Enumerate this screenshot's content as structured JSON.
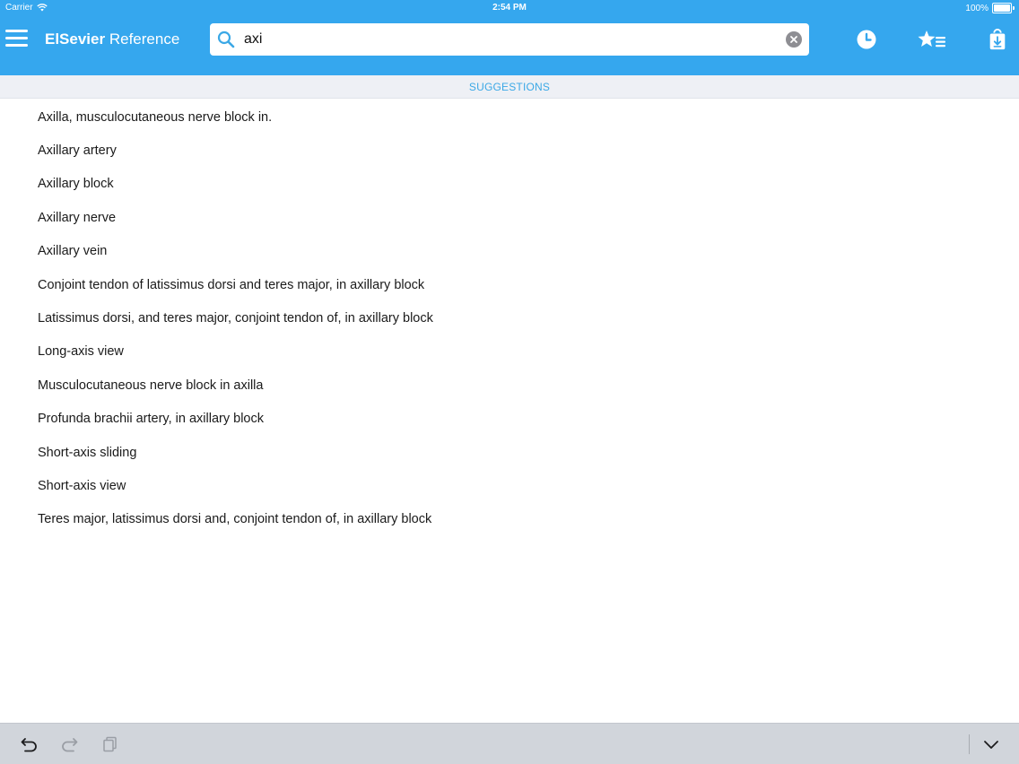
{
  "status_bar": {
    "carrier": "Carrier",
    "time": "2:54 PM",
    "battery": "100%",
    "wifi_icon": "wifi-icon",
    "battery_icon": "battery-icon"
  },
  "nav": {
    "menu_icon": "hamburger-menu-icon",
    "brand_bold": "ElSevier",
    "brand_light": "Reference",
    "search": {
      "value": "axi",
      "icon": "search-icon",
      "clear_icon": "clear-icon"
    },
    "actions": [
      "history-clock-icon",
      "favorites-list-icon",
      "downloads-icon"
    ],
    "accent_color": "#35a7ee"
  },
  "suggestions": {
    "header": "SUGGESTIONS",
    "items": [
      "Axilla, musculocutaneous nerve block in.",
      "Axillary artery",
      "Axillary block",
      "Axillary nerve",
      "Axillary vein",
      "Conjoint tendon of latissimus dorsi and teres major, in axillary block",
      "Latissimus dorsi, and teres major, conjoint tendon of, in axillary block",
      "Long-axis view",
      "Musculocutaneous nerve block in axilla",
      "Profunda brachii artery, in axillary block",
      "Short-axis sliding",
      "Short-axis view",
      "Teres major, latissimus dorsi and, conjoint tendon of, in axillary block"
    ]
  },
  "keyboard_toolbar": {
    "buttons": [
      "undo-icon",
      "redo-icon",
      "paste-icon",
      "dismiss-keyboard-icon"
    ]
  }
}
